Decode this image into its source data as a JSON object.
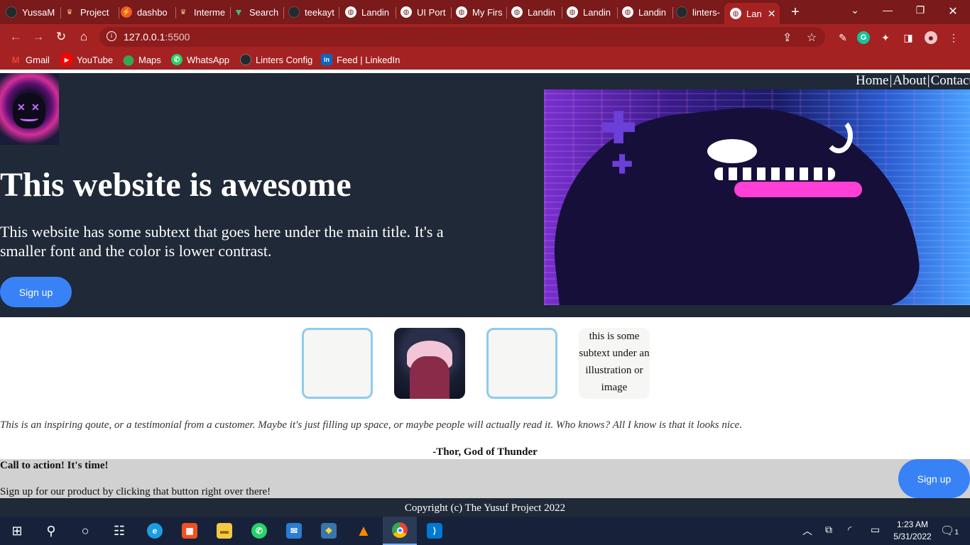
{
  "browser": {
    "tabs": [
      {
        "title": "YussaM",
        "icon": "github-icon",
        "color": "#24292e"
      },
      {
        "title": "Project",
        "icon": "microverse-icon",
        "color": "#7a1a1a"
      },
      {
        "title": "dashbo",
        "icon": "postman-icon",
        "color": "#ef5b25"
      },
      {
        "title": "Interme",
        "icon": "microverse-icon",
        "color": "#7a1a1a"
      },
      {
        "title": "Search",
        "icon": "vue-icon",
        "color": "#41b883"
      },
      {
        "title": "teekayt",
        "icon": "github-icon",
        "color": "#24292e"
      },
      {
        "title": "Landin",
        "icon": "globe-icon",
        "color": "#ffffff"
      },
      {
        "title": "UI Port",
        "icon": "globe-icon",
        "color": "#ffffff"
      },
      {
        "title": "My Firs",
        "icon": "globe-icon",
        "color": "#ffffff"
      },
      {
        "title": "Landin",
        "icon": "globe-icon",
        "color": "#ffffff"
      },
      {
        "title": "Landin",
        "icon": "globe-icon",
        "color": "#ffffff"
      },
      {
        "title": "Landin",
        "icon": "globe-icon",
        "color": "#ffffff"
      },
      {
        "title": "linters-",
        "icon": "github-icon",
        "color": "#24292e"
      },
      {
        "title": "Lan",
        "icon": "globe-icon",
        "color": "#ffffff",
        "active": true
      }
    ],
    "url_host": "127.0.0.1",
    "url_port": ":5500",
    "bookmarks": [
      {
        "label": "Gmail",
        "icon": "gmail-icon",
        "color": "#ea4335"
      },
      {
        "label": "YouTube",
        "icon": "youtube-icon",
        "color": "#ff0000"
      },
      {
        "label": "Maps",
        "icon": "maps-icon",
        "color": "#34a853"
      },
      {
        "label": "WhatsApp",
        "icon": "whatsapp-icon",
        "color": "#25d366"
      },
      {
        "label": "Linters Config",
        "icon": "github-icon",
        "color": "#24292e"
      },
      {
        "label": "Feed | LinkedIn",
        "icon": "linkedin-icon",
        "color": "#0a66c2"
      }
    ]
  },
  "page": {
    "nav": {
      "home": "Home",
      "about": "About",
      "contact": "Contact",
      "separator": "|"
    },
    "hero": {
      "title": "This website is awesome",
      "subtitle": "This website has some subtext that goes here under the main title. It's a smaller font and the color is lower contrast.",
      "button": "Sign up"
    },
    "card_caption": "this is some subtext under an illustration or image",
    "quote": "This is an inspiring qoute, or a testimonial from a customer. Maybe it's just filling up space, or maybe people will actually read it. Who knows? All I know is that it looks nice.",
    "quote_author": "-Thor, God of Thunder",
    "cta": {
      "title": "Call to action! It's time!",
      "text": "Sign up for our product by clicking that button right over there!",
      "button": "Sign up"
    },
    "footer": "Copyright (c) The Yusuf Project 2022",
    "colors": {
      "hero_bg": "#1f2937",
      "button_blue": "#3882f6",
      "card_border": "#8ecbef",
      "cta_bg": "#d1d1d1"
    }
  },
  "taskbar": {
    "time": "1:23 AM",
    "date": "5/31/2022",
    "notifications": "1"
  }
}
